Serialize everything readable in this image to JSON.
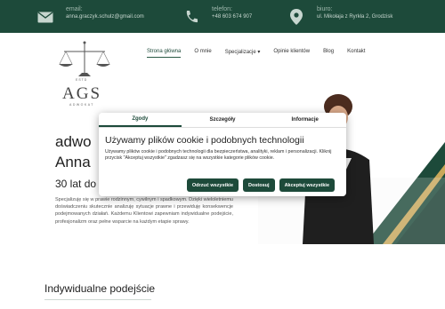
{
  "topbar": {
    "email": {
      "label": "email:",
      "value": "anna.graczyk.schulz@gmail.com"
    },
    "phone": {
      "label": "telefon:",
      "value": "+48 603 674 907"
    },
    "address": {
      "label": "biuro:",
      "value": "ul. Mikołaja z Ryrkła 2, Grodzisk"
    }
  },
  "logo": {
    "est": "ESTD",
    "name": "AGS",
    "sub": "ADWOKAT"
  },
  "nav": {
    "items": [
      "Strona główna",
      "O mnie",
      "Specjalizacje ▾",
      "Opinie klientów",
      "Blog",
      "Kontakt"
    ]
  },
  "hero": {
    "title_line1": "adwo",
    "title_line2": "Anna",
    "subtitle": "30 lat do",
    "body": "Specjalizuję się w prawie rodzinnym, cywilnym i spadkowym. Dzięki wieloletniemu doświadczeniu skutecznie analizuję sytuacje prawne i przewiduję konsekwencje podejmowanych działań. Każdemu Klientowi zapewniam indywidualne podejście, profesjonalizm oraz pełne wsparcie na każdym etapie sprawy."
  },
  "section": {
    "title": "Indywidualne podejście"
  },
  "cookie": {
    "tabs": [
      "Zgody",
      "Szczegóły",
      "Informacje"
    ],
    "title": "Używamy plików cookie i podobnych technologii",
    "body": "Używamy plików cookie i podobnych technologii dla bezpieczeństwa, analityki, reklam i personalizacji. Kliknij przycisk \"Akceptuj wszystkie\" zgadzasz się na wszystkie kategorie plików cookie.",
    "buttons": {
      "reject": "Odrzuć wszystkie",
      "customize": "Dostosuj",
      "accept": "Akceptuj wszystkie"
    }
  },
  "colors": {
    "brand": "#1d4a3a",
    "gold": "#c9a85a"
  }
}
